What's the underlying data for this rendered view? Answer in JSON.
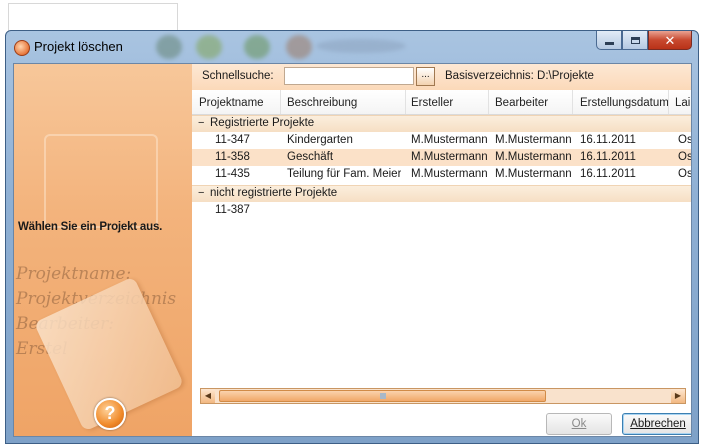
{
  "window": {
    "title": "Projekt löschen"
  },
  "sidebar": {
    "prompt": "Wählen Sie ein Projekt aus.",
    "help_glyph": "?"
  },
  "search": {
    "label": "Schnellsuche:",
    "value": "",
    "browse_label": "...",
    "base_dir": "Basisverzeichnis: D:\\Projekte"
  },
  "table": {
    "columns": [
      "Projektname",
      "Beschreibung",
      "Ersteller",
      "Bearbeiter",
      "Erstellungsdatum",
      "Lai"
    ],
    "groups": [
      {
        "label": "Registrierte Projekte",
        "toggle": "−",
        "rows": [
          [
            "11-347",
            "Kindergarten",
            "M.Mustermann",
            "M.Mustermann",
            "16.11.2011",
            "Ös"
          ],
          [
            "11-358",
            "Geschäft",
            "M.Mustermann",
            "M.Mustermann",
            "16.11.2011",
            "Ös"
          ],
          [
            "11-435",
            "Teilung für Fam. Meier",
            "M.Mustermann",
            "M.Mustermann",
            "16.11.2011",
            "Ös"
          ]
        ]
      },
      {
        "label": "nicht registrierte Projekte",
        "toggle": "−",
        "rows": [
          [
            "11-387",
            "",
            "",
            "",
            "",
            ""
          ]
        ]
      }
    ]
  },
  "buttons": {
    "ok": "Ok",
    "cancel": "Abbrechen"
  },
  "icons": {
    "title": "orange-circle-icon",
    "help": "help-icon",
    "minimize": "minimize-icon",
    "maximize": "maximize-icon",
    "close": "close-icon",
    "scroll_left": "scroll-left-arrow-icon",
    "scroll_right": "scroll-right-arrow-icon"
  },
  "colors": {
    "accent": "#f1a868",
    "row_alt": "#fbe1c8",
    "group_header": "#f6dfc4"
  }
}
